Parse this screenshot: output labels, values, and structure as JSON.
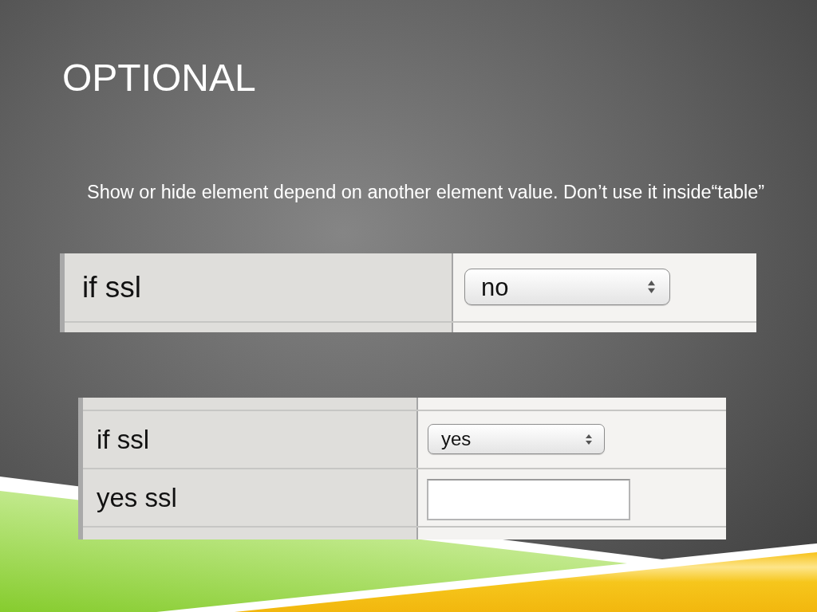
{
  "slide": {
    "title": "OPTIONAL",
    "body": "Show or hide element depend on another element value. Don’t use it inside“table”"
  },
  "examples": [
    {
      "rows": [
        {
          "label": "if ssl",
          "kind": "select",
          "value": "no"
        }
      ]
    },
    {
      "rows": [
        {
          "label": "if ssl",
          "kind": "select",
          "value": "yes"
        },
        {
          "label": "yes ssl",
          "kind": "text"
        }
      ]
    }
  ]
}
